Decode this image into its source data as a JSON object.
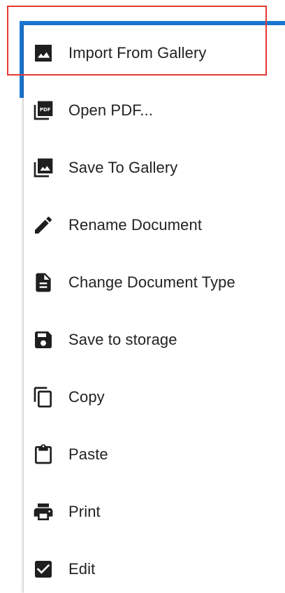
{
  "menu": {
    "items": [
      {
        "label": "Import From Gallery",
        "icon": "image-icon"
      },
      {
        "label": "Open PDF...",
        "icon": "pdf-icon"
      },
      {
        "label": "Save To Gallery",
        "icon": "gallery-stack-icon"
      },
      {
        "label": "Rename Document",
        "icon": "pencil-icon"
      },
      {
        "label": "Change Document Type",
        "icon": "document-icon"
      },
      {
        "label": "Save to storage",
        "icon": "floppy-disk-icon"
      },
      {
        "label": "Copy",
        "icon": "copy-icon"
      },
      {
        "label": "Paste",
        "icon": "clipboard-icon"
      },
      {
        "label": "Print",
        "icon": "printer-icon"
      },
      {
        "label": "Edit",
        "icon": "checkbox-checked-icon"
      }
    ]
  },
  "colors": {
    "accent": "#1976d2",
    "highlight": "#e53935",
    "icon": "#1f1f1f",
    "text": "#222222"
  }
}
